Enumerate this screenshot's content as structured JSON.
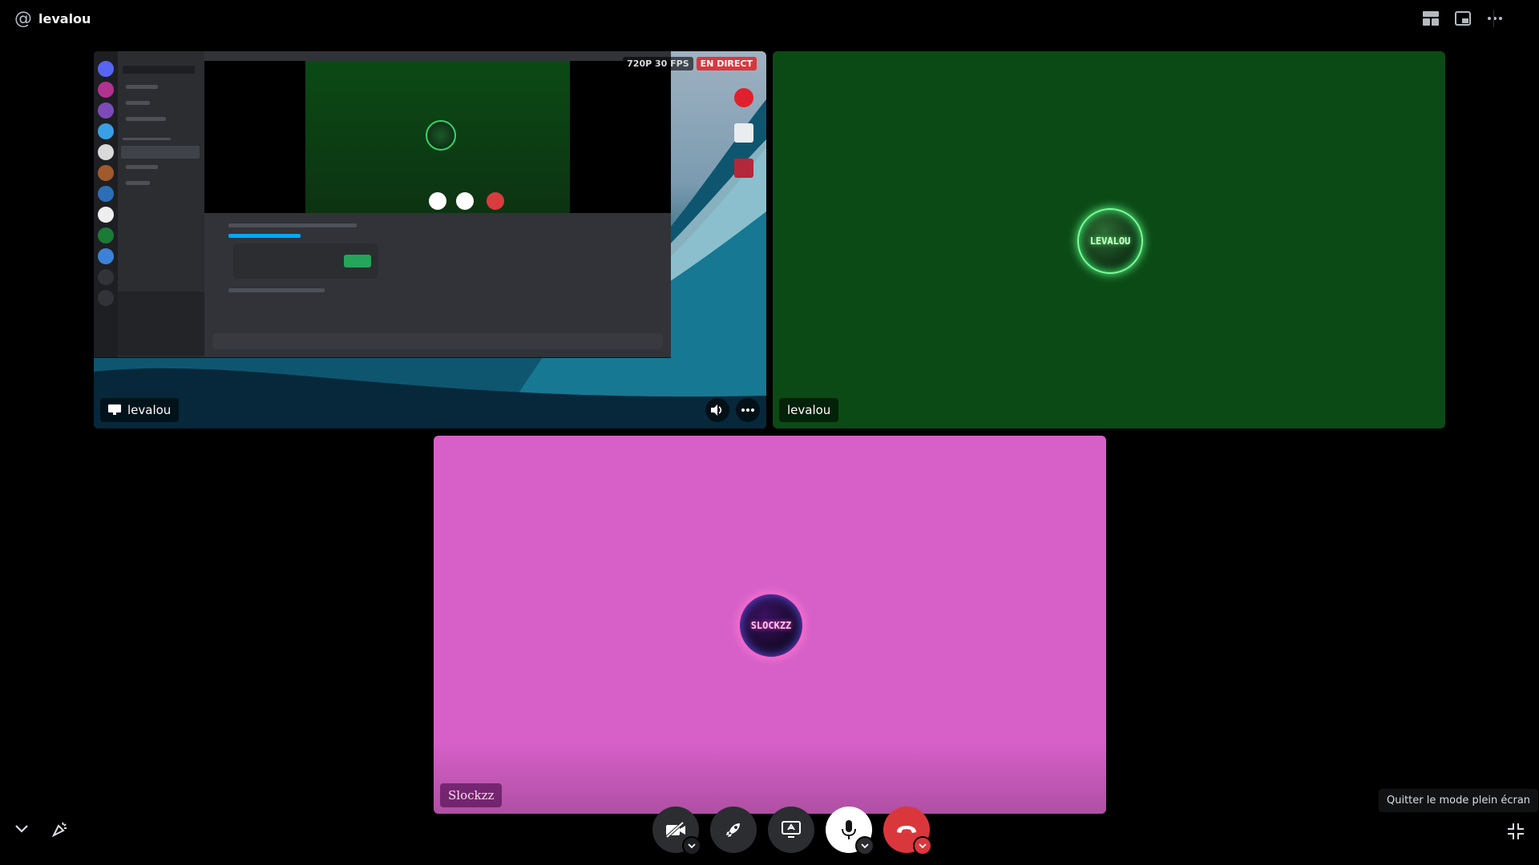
{
  "header": {
    "at_symbol": "@",
    "title": "levalou"
  },
  "tiles": {
    "screen": {
      "quality_badge": "720P 30 FPS",
      "live_badge": "EN DIRECT",
      "name": "levalou"
    },
    "green": {
      "name": "levalou",
      "avatar_text": "LEVALOU",
      "accent": "#0b4a15"
    },
    "pink": {
      "name": "Slockzz",
      "avatar_text": "SLOCKZZ",
      "accent": "#d660c8"
    }
  },
  "tooltip": "Quitter le mode plein écran",
  "colors": {
    "hangup": "#da373c",
    "control_bg": "#2b2d31"
  }
}
